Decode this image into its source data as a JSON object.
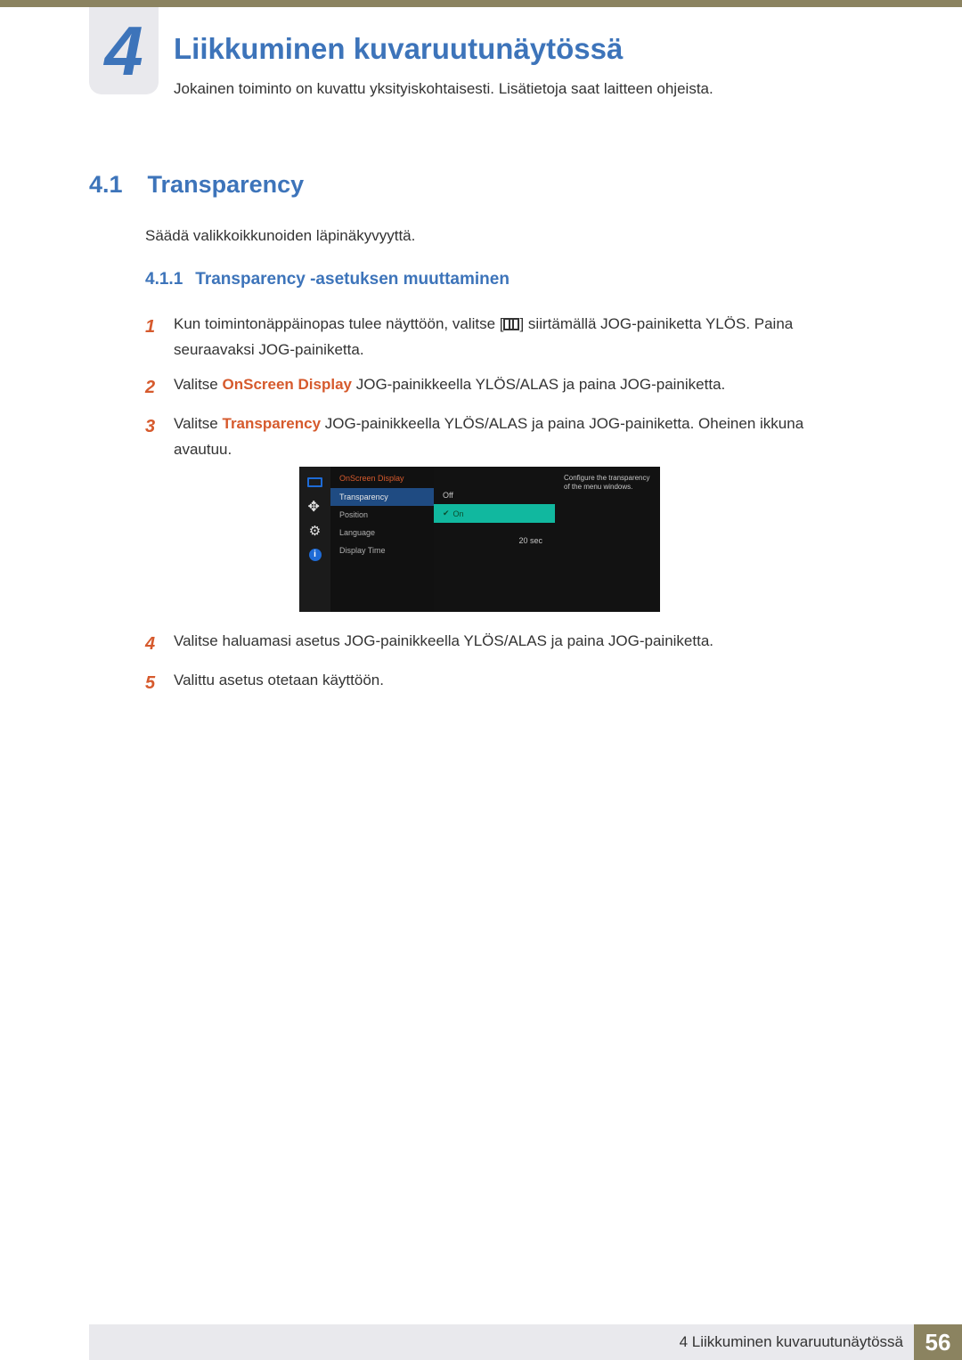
{
  "chapter": {
    "number": "4",
    "title": "Liikkuminen kuvaruutunäytössä",
    "subtitle": "Jokainen toiminto on kuvattu yksityiskohtaisesti. Lisätietoja saat laitteen ohjeista."
  },
  "section": {
    "number": "4.1",
    "title": "Transparency",
    "intro": "Säädä valikkoikkunoiden läpinäkyvyyttä."
  },
  "subsection": {
    "number": "4.1.1",
    "title": "Transparency -asetuksen muuttaminen"
  },
  "steps": {
    "s1a": "Kun toimintonäppäinopas tulee näyttöön, valitse [",
    "s1b": "] siirtämällä JOG-painiketta YLÖS. Paina seuraavaksi JOG-painiketta.",
    "s2a": "Valitse ",
    "s2hl": "OnScreen Display",
    "s2b": " JOG-painikkeella YLÖS/ALAS ja paina JOG-painiketta.",
    "s3a": "Valitse ",
    "s3hl": "Transparency",
    "s3b": " JOG-painikkeella YLÖS/ALAS ja paina JOG-painiketta. Oheinen ikkuna avautuu.",
    "s4": "Valitse haluamasi asetus JOG-painikkeella YLÖS/ALAS ja paina JOG-painiketta.",
    "s5": "Valittu asetus otetaan käyttöön."
  },
  "step_nums": {
    "n1": "1",
    "n2": "2",
    "n3": "3",
    "n4": "4",
    "n5": "5"
  },
  "osd": {
    "header": "OnScreen Display",
    "items": {
      "transparency": "Transparency",
      "position": "Position",
      "language": "Language",
      "display_time": "Display Time"
    },
    "options": {
      "off": "Off",
      "on": "On",
      "display_time_value": "20 sec"
    },
    "help": "Configure the transparency of the menu windows.",
    "side_icons": {
      "info_letter": "i"
    }
  },
  "footer": {
    "text": "4 Liikkuminen kuvaruutunäytössä",
    "page": "56"
  }
}
